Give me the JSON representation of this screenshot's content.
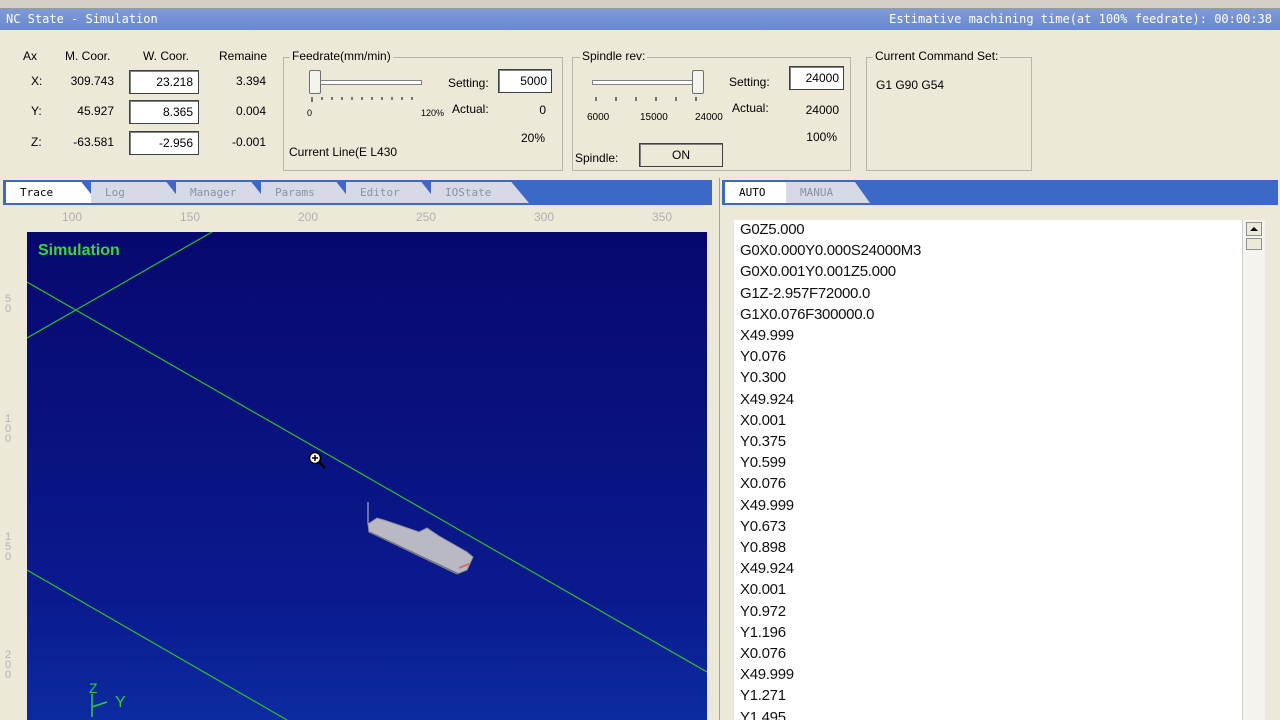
{
  "title": {
    "left": "NC State - Simulation",
    "right": "Estimative machining time(at 100% feedrate): 00:00:38"
  },
  "coords": {
    "headers": [
      "Ax",
      "M. Coor.",
      "W. Coor.",
      "Remaine"
    ],
    "rows": [
      {
        "axis": "X:",
        "m": "309.743",
        "w": "23.218",
        "rem": "3.394"
      },
      {
        "axis": "Y:",
        "m": "45.927",
        "w": "8.365",
        "rem": "0.004"
      },
      {
        "axis": "Z:",
        "m": "-63.581",
        "w": "-2.956",
        "rem": "-0.001"
      }
    ]
  },
  "feedrate": {
    "title": "Feedrate(mm/min)",
    "min_label": "0",
    "max_label": "120%",
    "setting_label": "Setting:",
    "setting_value": "5000",
    "actual_label": "Actual:",
    "actual_value": "0",
    "percent": "20%",
    "level_percent": 0,
    "current_line": "Current Line(E  L430"
  },
  "spindle": {
    "title": "Spindle rev:",
    "ticks": [
      "6000",
      "15000",
      "24000"
    ],
    "setting_label": "Setting:",
    "setting_value": "24000",
    "actual_label": "Actual:",
    "actual_value": "24000",
    "percent": "100%",
    "spindle_label": "Spindle:",
    "state": "ON"
  },
  "command_set": {
    "title": "Current Command Set:",
    "value": "G1 G90 G54"
  },
  "left_tabs": [
    "Trace",
    "Log",
    "Manager",
    "Params",
    "Editor",
    "IOState"
  ],
  "ruler": {
    "h": [
      "100",
      "150",
      "200",
      "250",
      "300",
      "350"
    ],
    "v": [
      "50",
      "100",
      "150",
      "200"
    ]
  },
  "viewport": {
    "label": "Simulation",
    "axis_z": "Z",
    "axis_y": "Y",
    "label_color": "#39D739",
    "line_color": "#2EBF2E"
  },
  "right_tabs": [
    "AUTO",
    "MANUA"
  ],
  "code_lines": [
    "G0Z5.000",
    "G0X0.000Y0.000S24000M3",
    "G0X0.001Y0.001Z5.000",
    "G1Z-2.957F72000.0",
    "G1X0.076F300000.0",
    "X49.999",
    "Y0.076",
    "Y0.300",
    "X49.924",
    "X0.001",
    "Y0.375",
    "Y0.599",
    "X0.076",
    "X49.999",
    "Y0.673",
    "Y0.898",
    "X49.924",
    "X0.001",
    "Y0.972",
    "Y1.196",
    "X0.076",
    "X49.999",
    "Y1.271",
    "Y1.495"
  ]
}
